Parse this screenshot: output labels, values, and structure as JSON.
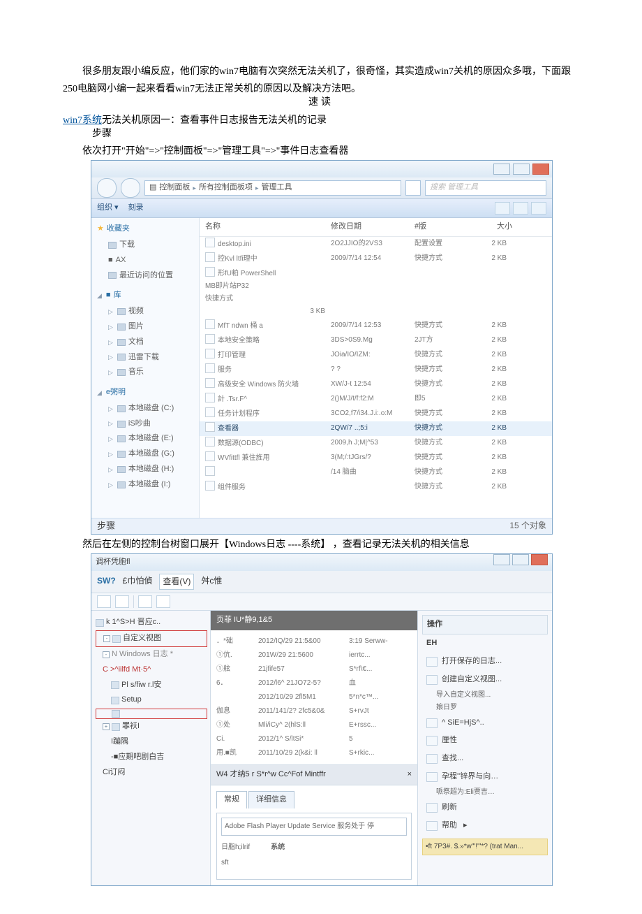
{
  "article": {
    "intro": "很多朋友跟小编反应，他们家的win7电脑有次突然无法关机了，很奇怪，其实造成win7关机的原因众多哦，下面跟250电脑网小编一起来看看win7无法正常关机的原因以及解决方法吧。",
    "intro_overlap": "速读",
    "link_text": "win7系统",
    "cause1_a": "无法关机原因一：查看事件日志报告无法关机的记录",
    "cause1_b": "步骤",
    "path_a": "依次打开\"开始\"=>\"控制面板\"=>\"管理工具\"=>\"事件日志查看器",
    "after1": "步骤",
    "trans": "然后在左侧的控制台树窗口展开【Windows日志 ----系统】 ，查看记录无法关机的相关信息"
  },
  "explorer": {
    "breadcrumb": [
      "控制面板",
      "所有控制面板项",
      "管理工具"
    ],
    "search_placeholder": "搜索 管理工具",
    "toolbar": {
      "org": "组织 ▾",
      "burn": "刻录"
    },
    "sidebar": {
      "fav": "收藏夹",
      "fav_items": [
        "下载",
        "AX",
        "最近访问的位置"
      ],
      "lib": "库",
      "lib_items": [
        "视频",
        "图片",
        "文档",
        "迅雷下载",
        "音乐"
      ],
      "other": "e粥明",
      "drives": [
        "本地磁盘 (C:)",
        "iS吵曲",
        "本地磁盘 (E:)",
        "本地磁盘 (G:)",
        "本地磁盘 (H:)",
        "本地磁盘 (I:)"
      ]
    },
    "columns": {
      "name": "名称",
      "date": "修改日期",
      "type": "#版",
      "size": "大小"
    },
    "rows": [
      {
        "name": "desktop.ini",
        "date": "2O2JJIO的2VS3",
        "type": "配置设置",
        "size": "2 KB"
      },
      {
        "name": "控Kvl ltfi理中",
        "date": "2009/7/14 12:54",
        "type": "快捷方式",
        "size": "2 KB"
      },
      {
        "name": "形fU粕 PowerShell<KJ.tt",
        "date": "MB即片站P32",
        "type": "快捷方式",
        "size": "3 KB"
      },
      {
        "name": "MfT ndwn 桶 a",
        "date": "2009/7/14 12:53",
        "type": "快捷方式",
        "size": "2 KB"
      },
      {
        "name": "本地安全策略",
        "date": "3DS>0S9.Mg",
        "type": "2JT方",
        "size": "2 KB"
      },
      {
        "name": "打印管理",
        "date": "JOia/IO/IZM:",
        "type": "快捷方式",
        "size": "2 KB"
      },
      {
        "name": "服务",
        "date": "? ?",
        "type": "快捷方式",
        "size": "2 KB"
      },
      {
        "name": "高级安全 Windows 防火墙",
        "date": "XW/J-t 12:54",
        "type": "快捷方式",
        "size": "2 KB"
      },
      {
        "name": "計 .Tsr.F^",
        "date": "2()M/J/t/f:f2:M",
        "type": "即5",
        "size": "2 KB"
      },
      {
        "name": "任务计划程序",
        "date": "3CO2,f7/i34.J.i:.o:M",
        "type": "快捷方式",
        "size": "2 KB"
      },
      {
        "name": "查看器",
        "date": "2QW/7 ..;5:i",
        "type": "快捷方式",
        "size": "2 KB"
      },
      {
        "name": "数据源(ODBC)",
        "date": "2009,h J;M|^53",
        "type": "快捷方式",
        "size": "2 KB"
      },
      {
        "name": "WVfittfl 兼住旌用",
        "date": "3(M;/:tJGrs/?",
        "type": "快捷方式",
        "size": "2 KB"
      },
      {
        "name": "",
        "date": "/14 脑曲",
        "type": "快捷方式",
        "size": "2 KB"
      },
      {
        "name": "组件服务",
        "date": "",
        "type": "快捷方式",
        "size": "2 KB"
      }
    ],
    "status": "15 个对象"
  },
  "event_viewer": {
    "title": "调杯凭胞fl",
    "menu": [
      "SW?",
      "£巾怕偵",
      "查看(V)",
      "舛c惟"
    ],
    "tree": {
      "root": "k 1^S>H 晋应c..",
      "custom": "自定义视图",
      "winlogs_lbl": "N Windows 日志 *",
      "winlogs_garble": "C >^iilfd Mt·5^",
      "items": [
        "Pl s/fiw r.l安",
        "Setup",
        " ",
        "罪袄I",
        "I蹦隅",
        "-■应期吧剧白吉",
        "Ci订闷"
      ]
    },
    "center_head": "页菲  IU*静9,1&5",
    "list_rows": [
      {
        "a": "．*础",
        "b": "2012/IQ/29 21:5&00",
        "c": "3:19 Serww-"
      },
      {
        "a": "①伉.",
        "b": "201W/29 21:5600",
        "c": "ierrtc..."
      },
      {
        "a": "①舷",
        "b": "               21jfife57",
        "c": "S*rf\\€..."
      },
      {
        "a": "6．",
        "b": "2012/l6^ 21JO72-5?",
        "c": "血"
      },
      {
        "a": "",
        "b": "2012/10/29 2fl5M1",
        "c": "5*n*c™..."
      },
      {
        "a": "伽息",
        "b": "2011/141/2? 2fc5&0&",
        "c": "S+rvJt"
      },
      {
        "a": "①处",
        "b": "Mli/iCy^ 2(hlS:ll",
        "c": "E+rssc..."
      },
      {
        "a": "Ci.",
        "b": "2012/1^ S/ltSi*",
        "c": "5<nfeC"
      },
      {
        "a": "用.■凯",
        "b": "2011/10/29 2(k&i:  ll",
        "c": "S+rkic..."
      }
    ],
    "detail_title": "W4 才纳5 r S*r^w Cc^Fof Mintffr",
    "tabs": {
      "g": "常规",
      "d": "详细信息"
    },
    "detail_line": "Adobe Flash Player Update Service 服务处于 停",
    "detail_logs": {
      "lbl": "日脂h;ilrif",
      "val": "系统"
    },
    "detail_src": "sft",
    "actions": {
      "head1": "操作",
      "head2": "EH",
      "items": [
        "打开保存的日志...",
        "创建自定义视图...",
        "导入自定义视图...",
        "娘日罗",
        "^ SiE=HjS^..",
        "厘性",
        "查找...",
        "孕程''锌界与向…"
      ],
      "save_as": "哌祭超为:Eli贾吉…",
      "refresh": "刷新",
      "help": "帮助",
      "highlight": "•ft 7P3#. $.»*w'\"!'\"*?  (trat Man..."
    }
  }
}
